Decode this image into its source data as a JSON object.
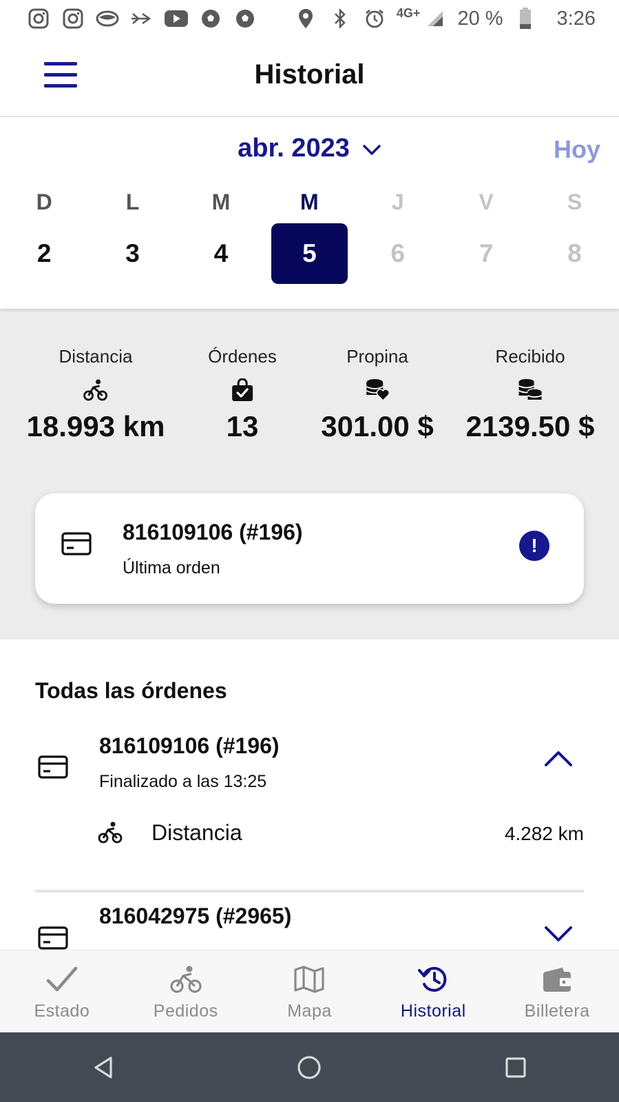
{
  "status_bar": {
    "network": "4G+",
    "battery": "20 %",
    "time": "3:26",
    "left_icons": [
      "instagram-icon",
      "instagram-icon",
      "messaging-icon",
      "dart-icon",
      "youtube-icon",
      "soccer-ball-icon",
      "soccer-ball-icon"
    ],
    "right_icons": [
      "location-icon",
      "bluetooth-icon",
      "alarm-icon",
      "signal-icon",
      "battery-icon"
    ]
  },
  "header": {
    "title": "Historial"
  },
  "calendar": {
    "month_label": "abr. 2023",
    "today_label": "Hoy",
    "days": [
      {
        "letter": "D",
        "num": "2",
        "state": "past"
      },
      {
        "letter": "L",
        "num": "3",
        "state": "past"
      },
      {
        "letter": "M",
        "num": "4",
        "state": "past"
      },
      {
        "letter": "M",
        "num": "5",
        "state": "selected"
      },
      {
        "letter": "J",
        "num": "6",
        "state": "future"
      },
      {
        "letter": "V",
        "num": "7",
        "state": "future"
      },
      {
        "letter": "S",
        "num": "8",
        "state": "future"
      }
    ]
  },
  "stats": {
    "distance": {
      "label": "Distancia",
      "value": "18.993 km",
      "icon": "bicycle-icon"
    },
    "orders": {
      "label": "Órdenes",
      "value": "13",
      "icon": "shopping-bag-check-icon"
    },
    "tip": {
      "label": "Propina",
      "value": "301.00 $",
      "icon": "coins-heart-icon"
    },
    "received": {
      "label": "Recibido",
      "value": "2139.50 $",
      "icon": "coin-stack-icon"
    }
  },
  "last_order": {
    "title": "816109106 (#196)",
    "subtitle": "Última orden",
    "icon": "credit-card-icon",
    "alert_icon": "alert-icon",
    "alert_mark": "!"
  },
  "orders_section": {
    "title": "Todas las órdenes",
    "items": [
      {
        "title": "816109106 (#196)",
        "subtitle": "Finalizado a las 13:25",
        "expanded": true,
        "detail": {
          "label": "Distancia",
          "value": "4.282 km"
        }
      },
      {
        "title": "816042975 (#2965)",
        "expanded": false
      }
    ]
  },
  "bottom_nav": [
    {
      "label": "Estado",
      "icon": "check-icon",
      "active": false
    },
    {
      "label": "Pedidos",
      "icon": "bicycle-icon",
      "active": false
    },
    {
      "label": "Mapa",
      "icon": "map-icon",
      "active": false
    },
    {
      "label": "Historial",
      "icon": "history-icon",
      "active": true
    },
    {
      "label": "Billetera",
      "icon": "wallet-icon",
      "active": false
    }
  ],
  "colors": {
    "primary": "#14148a",
    "selected_day": "#06065a",
    "today_link": "#8e98d8",
    "stats_bg": "#ececec",
    "system_nav": "#434a53"
  }
}
